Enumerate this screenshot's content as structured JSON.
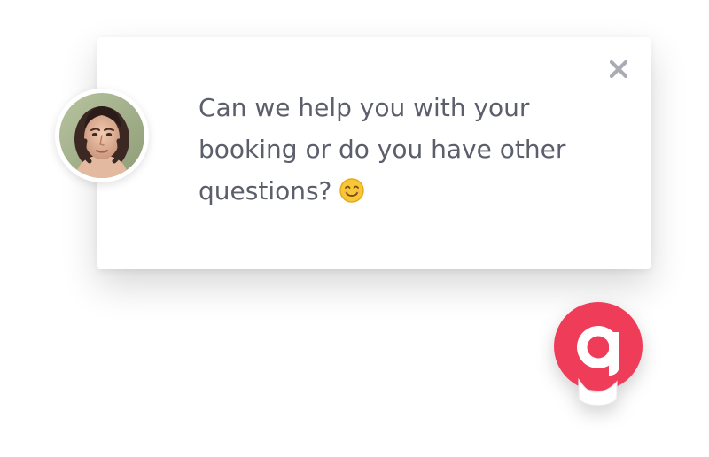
{
  "message": {
    "text": "Can we help you with your booking or do you have other questions?",
    "emoji": "smiling-face-icon"
  },
  "close": {
    "icon": "close-icon"
  },
  "avatar": {
    "icon": "agent-avatar"
  },
  "launcher": {
    "icon": "brand-logo-icon",
    "brand_color": "#ef3c59"
  },
  "colors": {
    "text": "#5c5f6b",
    "close": "#a9acb5",
    "card": "#ffffff"
  }
}
